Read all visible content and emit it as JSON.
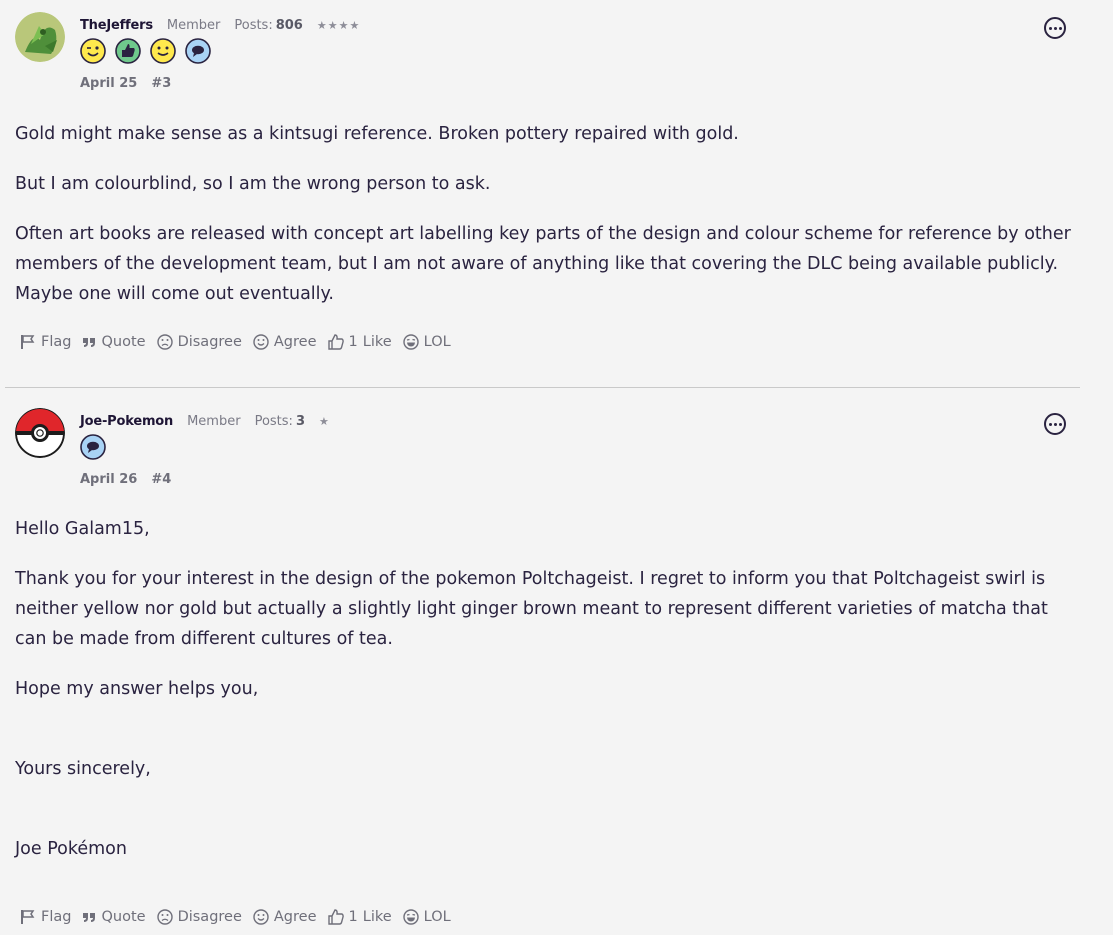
{
  "posts": [
    {
      "username": "TheJeffers",
      "role": "Member",
      "posts_label": "Posts:",
      "posts_count": "806",
      "stars": "★★★★",
      "date": "April 25",
      "post_number": "#3",
      "paragraphs": [
        "Gold might make sense as a kintsugi reference. Broken pottery repaired with gold.",
        "But I am colourblind, so I am the wrong person to ask.",
        "Often art books are released with concept art labelling key parts of the design and colour scheme for reference by other members of the development team, but I am not aware of anything like that covering the DLC being available publicly. Maybe one will come out eventually."
      ],
      "actions": {
        "flag": "Flag",
        "quote": "Quote",
        "disagree": "Disagree",
        "agree": "Agree",
        "like_count": "1",
        "like": "Like",
        "lol": "LOL"
      }
    },
    {
      "username": "Joe-Pokemon",
      "role": "Member",
      "posts_label": "Posts:",
      "posts_count": "3",
      "stars": "★",
      "date": "April 26",
      "post_number": "#4",
      "paragraphs": [
        "Hello Galam15,",
        "Thank you for your interest in the design of the pokemon Poltchageist. I regret to inform you that Poltchageist swirl is neither yellow nor gold but actually a slightly light ginger brown meant to represent different varieties of matcha that can be made from different cultures of tea.",
        "Hope my answer helps you,",
        "Yours sincerely,",
        "Joe Pokémon"
      ],
      "actions": {
        "flag": "Flag",
        "quote": "Quote",
        "disagree": "Disagree",
        "agree": "Agree",
        "like_count": "1",
        "like": "Like",
        "lol": "LOL"
      }
    }
  ],
  "colors": {
    "background": "#f4f4f4",
    "text": "#2a2340",
    "muted": "#6f6f7a",
    "divider": "#c9c9c9"
  }
}
